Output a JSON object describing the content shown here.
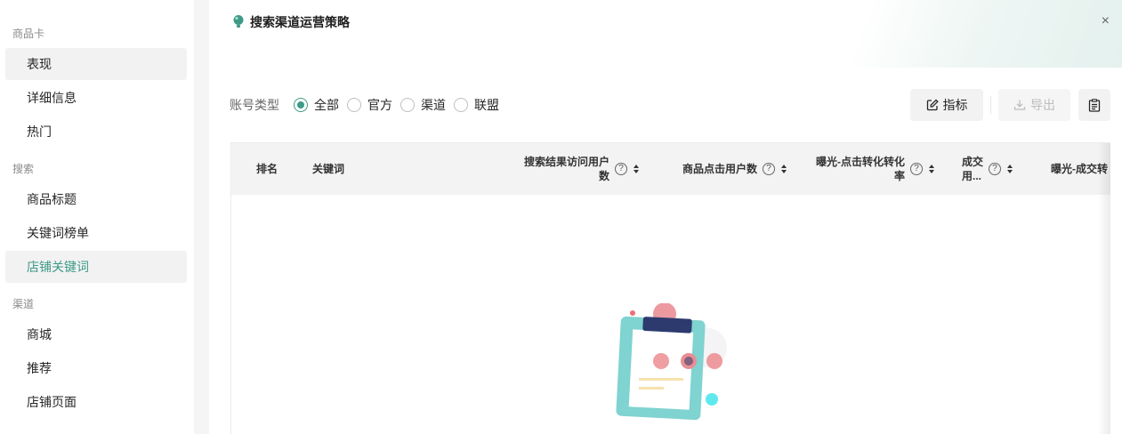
{
  "sidebar": {
    "groups": [
      {
        "label": "商品卡",
        "items": [
          "表现",
          "详细信息",
          "热门"
        ]
      },
      {
        "label": "搜索",
        "items": [
          "商品标题",
          "关键词榜单",
          "店铺关键词"
        ]
      },
      {
        "label": "渠道",
        "items": [
          "商城",
          "推荐",
          "店铺页面"
        ]
      }
    ],
    "active_item": "店铺关键词"
  },
  "panel": {
    "title": "搜索渠道运营策略",
    "close_symbol": "×"
  },
  "filter": {
    "label": "账号类型",
    "options": [
      "全部",
      "官方",
      "渠道",
      "联盟"
    ],
    "selected": "全部"
  },
  "toolbar": {
    "metrics_label": "指标",
    "export_label": "导出"
  },
  "table": {
    "columns": [
      {
        "label": "排名"
      },
      {
        "label": "关键词"
      },
      {
        "label": "搜索结果访问用户数",
        "line1": "搜索结果访问用户",
        "line2": "数",
        "help": true,
        "sortable": true
      },
      {
        "label": "商品点击用户数",
        "help": true,
        "sortable": true
      },
      {
        "label": "曝光-点击转化率",
        "line1": "曝光-点击转化转化",
        "line2": "率",
        "help": true,
        "sortable": true
      },
      {
        "label": "成交用...",
        "line1": "成交",
        "line2": "用...",
        "help": true,
        "sortable": true
      },
      {
        "label": "曝光-成交转"
      }
    ],
    "rows": []
  },
  "colors": {
    "accent": "#3d9a86",
    "header_bg": "#f3f3f3",
    "sidebar_active_bg": "#f2f2f2"
  }
}
